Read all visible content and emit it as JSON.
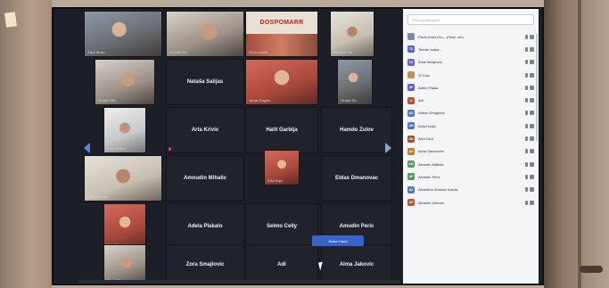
{
  "participants_panel": {
    "search_placeholder": "Find a participant",
    "rows": [
      {
        "initials": "",
        "name": "Pavlo Aravi (Ho... (Host, me)",
        "color": "#7a8aa8"
      },
      {
        "initials": "TS",
        "name": "Teodor Isaka...",
        "color": "#5b63c9"
      },
      {
        "initials": "ZS",
        "name": "Zora Smajlovic",
        "color": "#6f5cc4"
      },
      {
        "initials": "",
        "name": "Vl Colo",
        "color": "#c58f52"
      },
      {
        "initials": "AF",
        "name": "Adem Fliaka",
        "color": "#5b63c9"
      },
      {
        "initials": "A",
        "name": "Adi",
        "color": "#c0512f"
      },
      {
        "initials": "AS",
        "name": "Adnan Smajlovic",
        "color": "#4f77c9"
      },
      {
        "initials": "AH",
        "name": "Aida Hodja",
        "color": "#4f77c9"
      },
      {
        "initials": "AD",
        "name": "Alen Duzi",
        "color": "#a0532f"
      },
      {
        "initials": "AS",
        "name": "Alma Sabanovic",
        "color": "#c07a2a"
      },
      {
        "initials": "AM",
        "name": "Almedin Mililidic",
        "color": "#4f9a5c"
      },
      {
        "initials": "AP",
        "name": "Almedin Peric",
        "color": "#4f9a5c"
      },
      {
        "initials": "AZ",
        "name": "Almedina Zukanic Kazda",
        "color": "#4f77c9"
      },
      {
        "initials": "AZ",
        "name": "Almedin Zukovic",
        "color": "#c0512f"
      }
    ]
  },
  "tiles": {
    "t01": "",
    "t02": "",
    "t03": "",
    "t04": "",
    "banner": "DOSPOMARR",
    "t05": "",
    "t06": "Nataša Salijas",
    "t07": "",
    "t08": "",
    "t09": "",
    "t10": "Arta Krivic",
    "t11": "Halit Garbija",
    "t12": "Hamdo Zulov",
    "t13": "",
    "t14": "Amnudin Mihalic",
    "t15": "",
    "t16": "Eldas Dmanovac",
    "t17": "",
    "t18": "Adela Plakalo",
    "t19": "Selmo Celly",
    "t20": "Amudin Peric",
    "t21": "",
    "t22": "Zora Smajlovic",
    "t23": "Adi",
    "t24": "Alma Jakovic"
  },
  "captions": {
    "c01": "Zaim Muso",
    "c02": "Leutrim Fis",
    "c03": "Ruza Lemiš",
    "c04": "Besiyak Sur",
    "c05": "Vedad Vifin",
    "c07": "Jonas Pagota",
    "c08": "Vedad Sa...",
    "c09": "Edin Hrabro",
    "c13": "Zdila Zukovic",
    "c15": "Arta Nujic",
    "c17": "Ilhija Zaimovic",
    "c21": "Zena Bihon"
  },
  "controls": {
    "raise_hand": "Raise Hand"
  },
  "colors": {
    "screen_bg": "#1c1f27",
    "panel_bg": "#f4f5f7",
    "accent": "#3a64c9"
  }
}
